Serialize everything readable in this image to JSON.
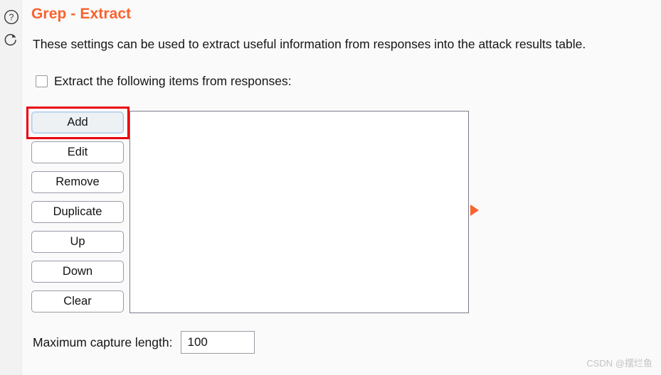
{
  "header": {
    "title": "Grep - Extract",
    "description": "These settings can be used to extract useful information from responses into the attack results table.",
    "title_color": "#f96330",
    "help_icon": "question-circle-icon",
    "refresh_icon": "refresh-circular-arrow-icon"
  },
  "options": {
    "extract_checkbox_label": "Extract the following items from responses:",
    "extract_checkbox_checked": false
  },
  "buttons": [
    {
      "label": "Add",
      "focused": true
    },
    {
      "label": "Edit",
      "focused": false
    },
    {
      "label": "Remove",
      "focused": false
    },
    {
      "label": "Duplicate",
      "focused": false
    },
    {
      "label": "Up",
      "focused": false
    },
    {
      "label": "Down",
      "focused": false
    },
    {
      "label": "Clear",
      "focused": false
    }
  ],
  "list_panel": {
    "items": [],
    "empty": true
  },
  "annotation": {
    "highlight_target": "Add",
    "highlight_color": "#e8000d",
    "pointer_color": "#f96330",
    "pointer_direction": "right"
  },
  "footer": {
    "max_capture_length_label": "Maximum capture length:",
    "max_capture_length_value": "100"
  },
  "watermark": {
    "text": "CSDN @摆烂鱼"
  }
}
